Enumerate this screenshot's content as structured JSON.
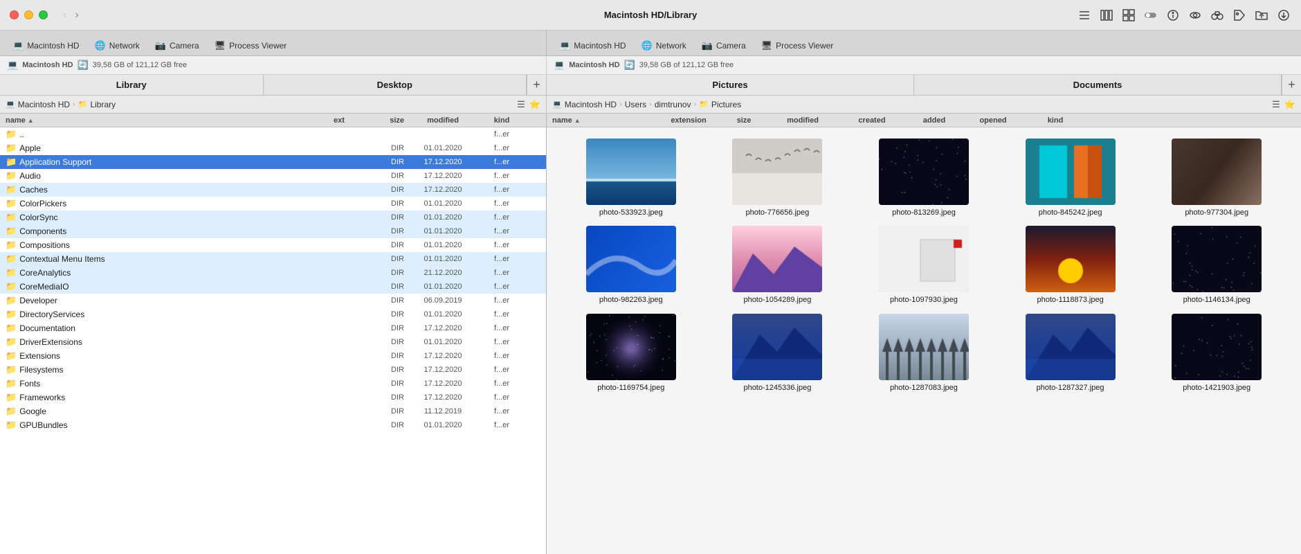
{
  "window": {
    "title": "Macintosh HD/Library"
  },
  "toolbar": {
    "back_label": "‹",
    "forward_label": "›",
    "icons": [
      "list-view",
      "column-view",
      "grid-view",
      "toggle-icon",
      "info-icon",
      "eye-icon",
      "binoculars-icon",
      "tag-icon",
      "folder-icon",
      "download-icon"
    ]
  },
  "left_tabs": [
    {
      "label": "Macintosh HD",
      "icon": "💻"
    },
    {
      "label": "Network",
      "icon": "🌐"
    },
    {
      "label": "Camera",
      "icon": "📷"
    },
    {
      "label": "Process Viewer",
      "icon": "🖥"
    }
  ],
  "right_tabs": [
    {
      "label": "Macintosh HD",
      "icon": "💻"
    },
    {
      "label": "Network",
      "icon": "🌐"
    },
    {
      "label": "Camera",
      "icon": "📷"
    },
    {
      "label": "Process Viewer",
      "icon": "🖥"
    }
  ],
  "left_storage": {
    "drive_icon": "💻",
    "drive_label": "Macintosh HD",
    "sync_label": "39,58 GB of 121,12 GB free"
  },
  "right_storage": {
    "drive_icon": "💻",
    "drive_label": "Macintosh HD",
    "sync_label": "39,58 GB of 121,12 GB free"
  },
  "left_panel": {
    "header": "Library",
    "breadcrumb": [
      "Macintosh HD",
      "Library"
    ],
    "col_headers": {
      "name": "name",
      "ext": "ext",
      "size": "size",
      "modified": "modified",
      "kind": "kind"
    }
  },
  "right_panels": [
    {
      "label": "Pictures"
    },
    {
      "label": "Documents"
    }
  ],
  "right_breadcrumb": [
    "Macintosh HD",
    "Users",
    "dimtrunov",
    "Pictures"
  ],
  "right_col_headers": {
    "name": "name",
    "extension": "extension",
    "size": "size",
    "modified": "modified",
    "created": "created",
    "added": "added",
    "opened": "opened",
    "kind": "kind"
  },
  "file_list": [
    {
      "name": "..",
      "size": "",
      "modified": "",
      "kind": "f...er",
      "type": "dotdot",
      "highlighted": false
    },
    {
      "name": "Apple",
      "size": "",
      "modified": "01.01.2020",
      "kind": "f...er",
      "type": "folder",
      "highlighted": false
    },
    {
      "name": "Application Support",
      "size": "",
      "modified": "17.12.2020",
      "kind": "f...er",
      "type": "folder",
      "highlighted": true,
      "selected": true
    },
    {
      "name": "Audio",
      "size": "",
      "modified": "17.12.2020",
      "kind": "f...er",
      "type": "folder",
      "highlighted": false
    },
    {
      "name": "Caches",
      "size": "",
      "modified": "17.12.2020",
      "kind": "f...er",
      "type": "folder",
      "highlighted": true
    },
    {
      "name": "ColorPickers",
      "size": "",
      "modified": "01.01.2020",
      "kind": "f...er",
      "type": "folder",
      "highlighted": false
    },
    {
      "name": "ColorSync",
      "size": "",
      "modified": "01.01.2020",
      "kind": "f...er",
      "type": "folder",
      "highlighted": true
    },
    {
      "name": "Components",
      "size": "",
      "modified": "01.01.2020",
      "kind": "f...er",
      "type": "folder",
      "highlighted": true
    },
    {
      "name": "Compositions",
      "size": "",
      "modified": "01.01.2020",
      "kind": "f...er",
      "type": "folder",
      "highlighted": false
    },
    {
      "name": "Contextual Menu Items",
      "size": "",
      "modified": "01.01.2020",
      "kind": "f...er",
      "type": "folder",
      "highlighted": true
    },
    {
      "name": "CoreAnalytics",
      "size": "",
      "modified": "21.12.2020",
      "kind": "f...er",
      "type": "folder",
      "highlighted": true
    },
    {
      "name": "CoreMediaIO",
      "size": "",
      "modified": "01.01.2020",
      "kind": "f...er",
      "type": "folder",
      "highlighted": true
    },
    {
      "name": "Developer",
      "size": "",
      "modified": "06.09.2019",
      "kind": "f...er",
      "type": "folder",
      "highlighted": false
    },
    {
      "name": "DirectoryServices",
      "size": "",
      "modified": "01.01.2020",
      "kind": "f...er",
      "type": "folder",
      "highlighted": false
    },
    {
      "name": "Documentation",
      "size": "",
      "modified": "17.12.2020",
      "kind": "f...er",
      "type": "folder",
      "highlighted": false
    },
    {
      "name": "DriverExtensions",
      "size": "",
      "modified": "01.01.2020",
      "kind": "f...er",
      "type": "folder",
      "highlighted": false
    },
    {
      "name": "Extensions",
      "size": "",
      "modified": "17.12.2020",
      "kind": "f...er",
      "type": "folder",
      "highlighted": false
    },
    {
      "name": "Filesystems",
      "size": "",
      "modified": "17.12.2020",
      "kind": "f...er",
      "type": "folder",
      "highlighted": false
    },
    {
      "name": "Fonts",
      "size": "",
      "modified": "17.12.2020",
      "kind": "f...er",
      "type": "folder",
      "highlighted": false
    },
    {
      "name": "Frameworks",
      "size": "",
      "modified": "17.12.2020",
      "kind": "f...er",
      "type": "folder",
      "highlighted": false
    },
    {
      "name": "Google",
      "size": "",
      "modified": "11.12.2019",
      "kind": "f...er",
      "type": "folder",
      "highlighted": false
    },
    {
      "name": "GPUBundles",
      "size": "",
      "modified": "01.01.2020",
      "kind": "f...er",
      "type": "folder",
      "highlighted": false
    }
  ],
  "photos": [
    {
      "name": "photo-533923.jpeg",
      "colors": [
        "#2a7ab8",
        "#5fa3d0",
        "#c8e0f0"
      ],
      "type": "beach"
    },
    {
      "name": "photo-776656.jpeg",
      "colors": [
        "#d4cfc8",
        "#a8a098",
        "#888078"
      ],
      "type": "birds"
    },
    {
      "name": "photo-813269.jpeg",
      "colors": [
        "#0a0a1a",
        "#1a1a3a",
        "#2a2a5a"
      ],
      "type": "space"
    },
    {
      "name": "photo-845242.jpeg",
      "colors": [
        "#00b8c8",
        "#008898",
        "#006878"
      ],
      "type": "doors"
    },
    {
      "name": "photo-977304.jpeg",
      "colors": [
        "#4a3830",
        "#382820",
        "#8a7060"
      ],
      "type": "sunset"
    },
    {
      "name": "photo-982263.jpeg",
      "colors": [
        "#1848a8",
        "#2868c8",
        "#4888d8"
      ],
      "type": "wave"
    },
    {
      "name": "photo-1054289.jpeg",
      "colors": [
        "#c87898",
        "#d898b8",
        "#e8b8d8"
      ],
      "type": "mountains"
    },
    {
      "name": "photo-1097930.jpeg",
      "colors": [
        "#e8e8e8",
        "#d0d0d0",
        "#f0f0f0"
      ],
      "type": "white"
    },
    {
      "name": "photo-1118873.jpeg",
      "colors": [
        "#d86820",
        "#c85018",
        "#e88830"
      ],
      "type": "sunset2"
    },
    {
      "name": "photo-1146134.jpeg",
      "colors": [
        "#080818",
        "#181828",
        "#100820"
      ],
      "type": "dark"
    },
    {
      "name": "photo-1169754.jpeg",
      "colors": [
        "#080818",
        "#181828",
        "#302850"
      ],
      "type": "galaxy"
    },
    {
      "name": "photo-1245336.jpeg",
      "colors": [
        "#2848a8",
        "#3858c8",
        "#183888"
      ],
      "type": "mountain2"
    },
    {
      "name": "photo-1287083.jpeg",
      "colors": [
        "#8898a8",
        "#9898a8",
        "#788898"
      ],
      "type": "fog"
    },
    {
      "name": "photo-1287327.jpeg",
      "colors": [
        "#2858a8",
        "#184888",
        "#3868b8"
      ],
      "type": "water"
    },
    {
      "name": "photo-1421903.jpeg",
      "colors": [
        "#080818",
        "#181828",
        "#100820"
      ],
      "type": "dark2"
    }
  ],
  "ui": {
    "dir_label": "DIR",
    "sort_arrow": "▲",
    "add_btn": "+",
    "list_icon": "≡",
    "star_icon": "⭐",
    "breadcrumb_sep": "›"
  }
}
